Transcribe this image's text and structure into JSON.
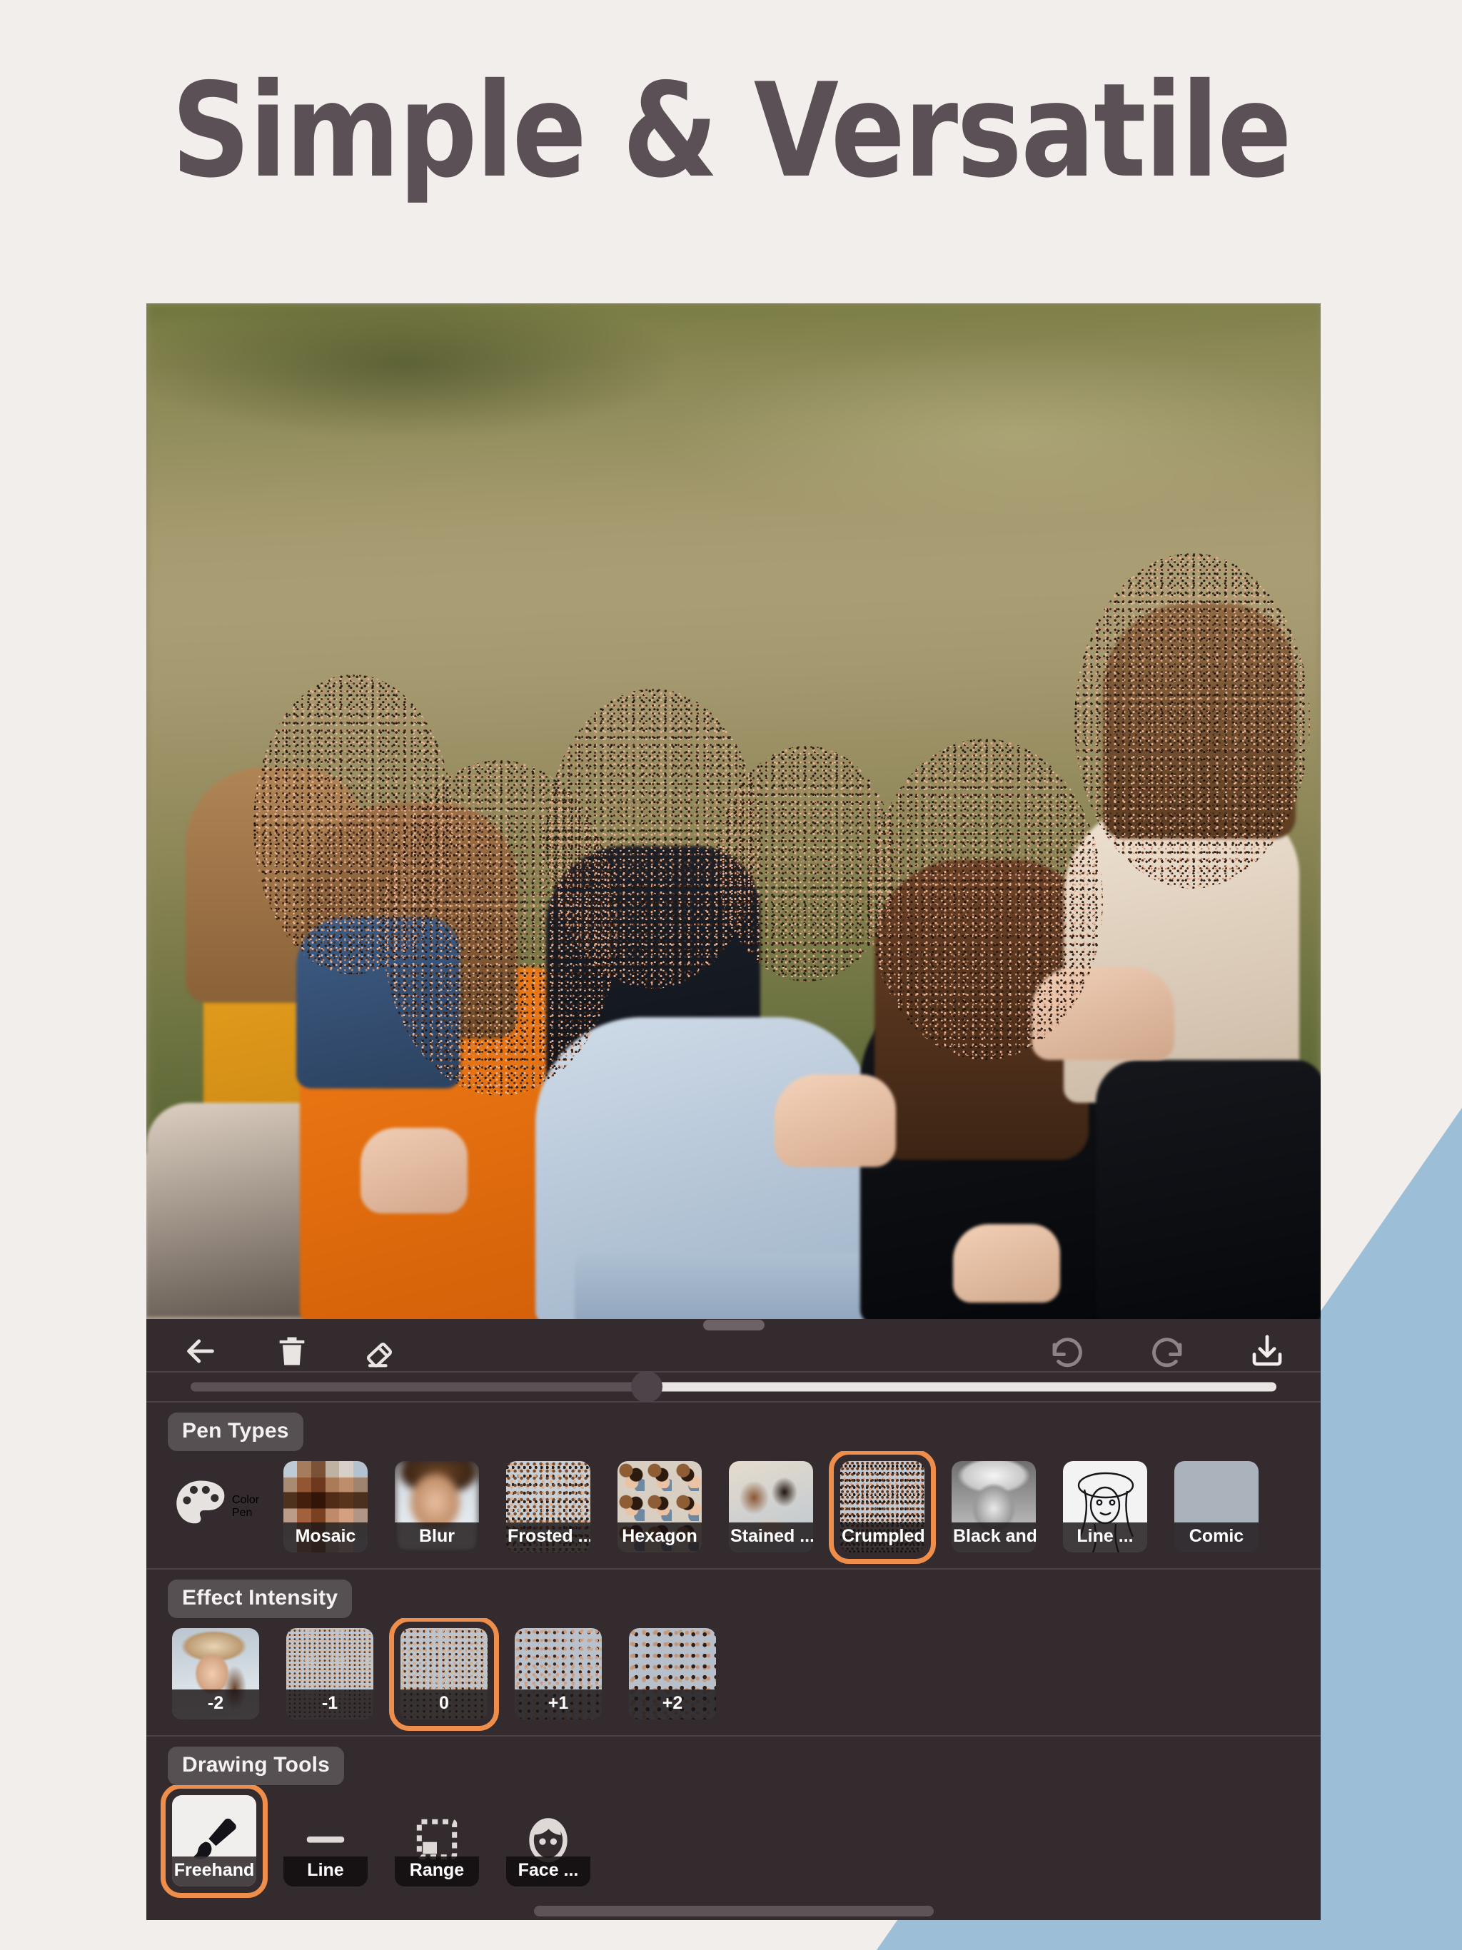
{
  "headline": "Simple & Versatile",
  "theme": {
    "page_bg": "#f2eeec",
    "headline_color": "#5a5055",
    "accent_blue": "#9cbfd7",
    "panel_bg": "#342b2e",
    "selection_orange": "#ef8e4b"
  },
  "toolbar": {
    "left": [
      {
        "name": "back-icon",
        "label": "Back"
      },
      {
        "name": "trash-icon",
        "label": "Delete"
      },
      {
        "name": "eraser-icon",
        "label": "Eraser"
      }
    ],
    "right": [
      {
        "name": "undo-icon",
        "label": "Undo"
      },
      {
        "name": "redo-icon",
        "label": "Redo"
      },
      {
        "name": "save-icon",
        "label": "Save"
      }
    ]
  },
  "brush_slider": {
    "label": "Brush Size",
    "value_percent": 42
  },
  "sections": [
    {
      "key": "pen_types",
      "label": "Pen Types",
      "items": [
        {
          "label": "Color Pen",
          "icon": "palette-icon",
          "selected": false
        },
        {
          "label": "Mosaic",
          "selected": false
        },
        {
          "label": "Blur",
          "selected": false
        },
        {
          "label": "Frosted ...",
          "selected": false
        },
        {
          "label": "Hexagon",
          "selected": false
        },
        {
          "label": "Stained ...",
          "selected": false
        },
        {
          "label": "Crumpled...",
          "selected": true
        },
        {
          "label": "Black and...",
          "selected": false
        },
        {
          "label": "Line ...",
          "selected": false
        },
        {
          "label": "Comic",
          "selected": false
        }
      ]
    },
    {
      "key": "effect_intensity",
      "label": "Effect Intensity",
      "items": [
        {
          "label": "-2",
          "selected": false
        },
        {
          "label": "-1",
          "selected": false
        },
        {
          "label": "0",
          "selected": true
        },
        {
          "label": "+1",
          "selected": false
        },
        {
          "label": "+2",
          "selected": false
        }
      ]
    },
    {
      "key": "drawing_tools",
      "label": "Drawing Tools",
      "items": [
        {
          "label": "Freehand",
          "icon": "brush-icon",
          "selected": true
        },
        {
          "label": "Line",
          "icon": "line-icon",
          "selected": false
        },
        {
          "label": "Range",
          "icon": "marquee-icon",
          "selected": false
        },
        {
          "label": "Face ...",
          "icon": "face-icon",
          "selected": false
        }
      ]
    }
  ]
}
